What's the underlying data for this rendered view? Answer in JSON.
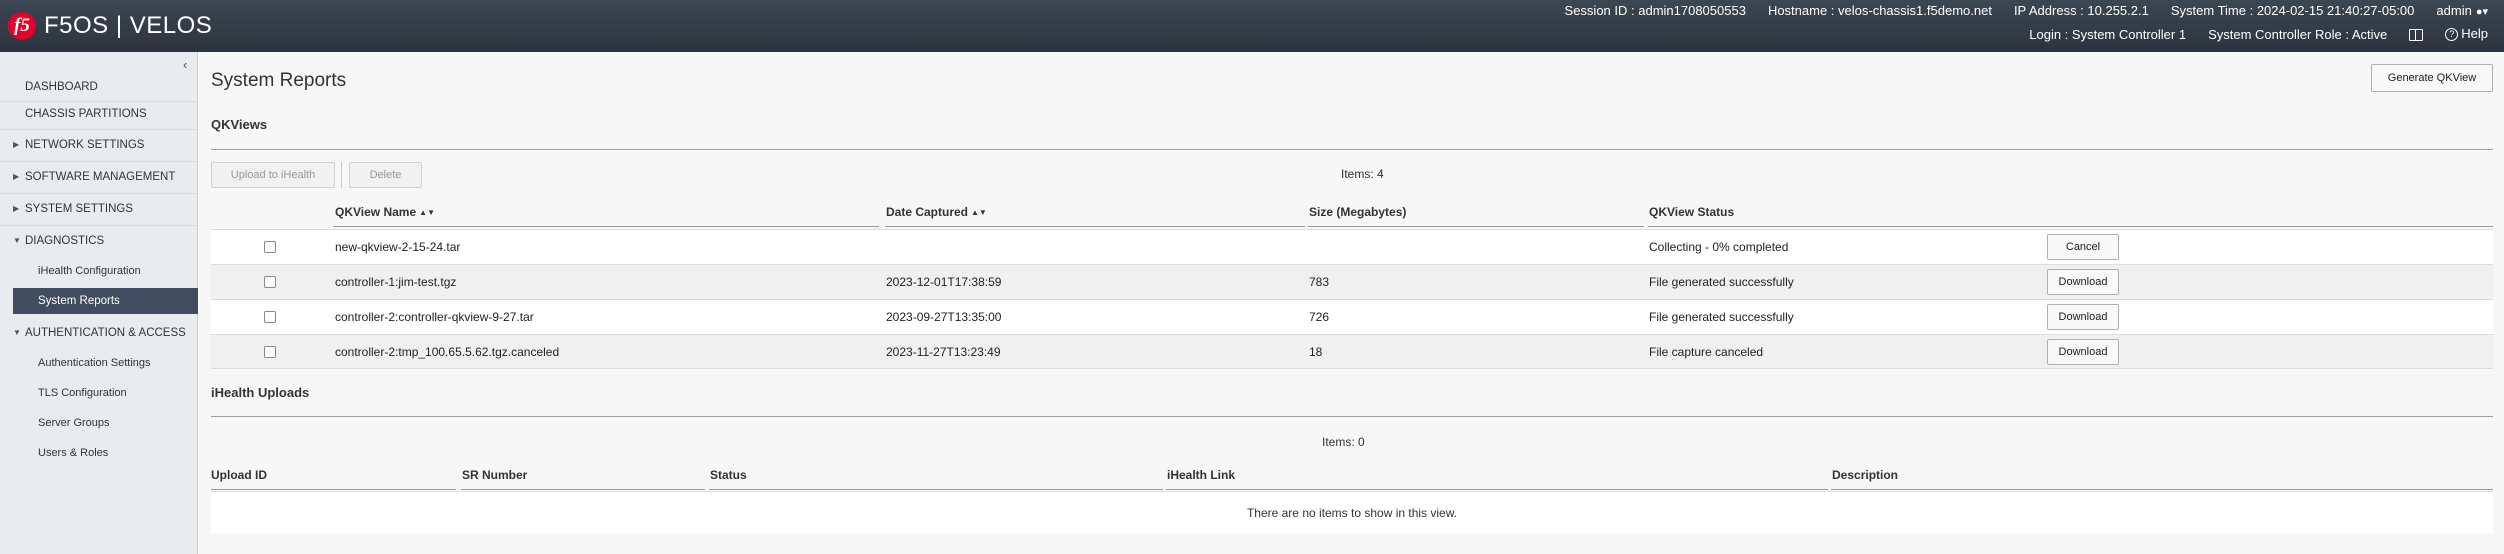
{
  "header": {
    "logo": "f5",
    "product": "F5OS | VELOS",
    "session": "Session ID : admin1708050553",
    "hostname": "Hostname : velos-chassis1.f5demo.net",
    "ip": "IP Address : 10.255.2.1",
    "time": "System Time : 2024-02-15 21:40:27-05:00",
    "user": "admin",
    "login": "Login : System Controller 1",
    "role": "System Controller Role : Active",
    "help": "Help"
  },
  "sidebar": {
    "collapse": "‹",
    "items": [
      {
        "label": "DASHBOARD"
      },
      {
        "label": "CHASSIS PARTITIONS"
      },
      {
        "label": "NETWORK SETTINGS"
      },
      {
        "label": "SOFTWARE MANAGEMENT"
      },
      {
        "label": "SYSTEM SETTINGS"
      },
      {
        "label": "DIAGNOSTICS"
      },
      {
        "label": "iHealth Configuration"
      },
      {
        "label": "System Reports"
      },
      {
        "label": "AUTHENTICATION & ACCESS"
      },
      {
        "label": "Authentication Settings"
      },
      {
        "label": "TLS Configuration"
      },
      {
        "label": "Server Groups"
      },
      {
        "label": "Users & Roles"
      }
    ]
  },
  "main": {
    "title": "System Reports",
    "generate_button": "Generate QKView",
    "qkviews": {
      "title": "QKViews",
      "upload_button": "Upload to iHealth",
      "delete_button": "Delete",
      "items_count": "Items: 4",
      "columns": [
        "QKView Name",
        "Date Captured",
        "Size (Megabytes)",
        "QKView Status"
      ],
      "rows": [
        {
          "name": "new-qkview-2-15-24.tar",
          "date": "",
          "size": "",
          "status": "Collecting - 0% completed",
          "action": "Cancel"
        },
        {
          "name": "controller-1:jim-test.tgz",
          "date": "2023-12-01T17:38:59",
          "size": "783",
          "status": "File generated successfully",
          "action": "Download"
        },
        {
          "name": "controller-2:controller-qkview-9-27.tar",
          "date": "2023-09-27T13:35:00",
          "size": "726",
          "status": "File generated successfully",
          "action": "Download"
        },
        {
          "name": "controller-2:tmp_100.65.5.62.tgz.canceled",
          "date": "2023-11-27T13:23:49",
          "size": "18",
          "status": "File capture canceled",
          "action": "Download"
        }
      ]
    },
    "ihealth": {
      "title": "iHealth Uploads",
      "items_count": "Items: 0",
      "columns": [
        "Upload ID",
        "SR Number",
        "Status",
        "iHealth Link",
        "Description"
      ],
      "empty_message": "There are no items to show in this view."
    }
  },
  "colors": {
    "header_bg": "#2f3842",
    "brand_red": "#e4002b",
    "nav_active": "#3f4d5f",
    "sidebar_bg": "#e9ecef"
  }
}
